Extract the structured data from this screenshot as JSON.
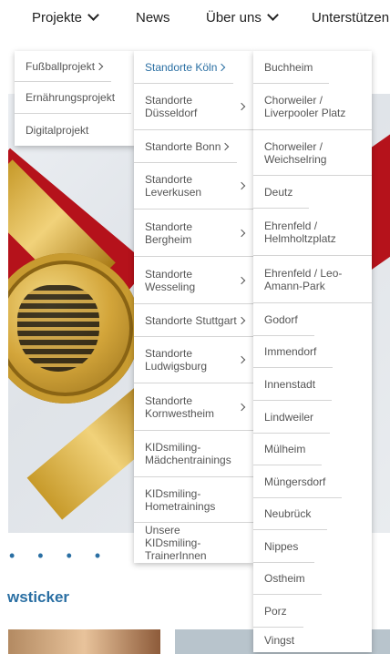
{
  "nav": {
    "items": [
      {
        "label": "Projekte",
        "has_chevron": true
      },
      {
        "label": "News",
        "has_chevron": false
      },
      {
        "label": "Über uns",
        "has_chevron": true
      },
      {
        "label": "Unterstützen",
        "has_chevron": false
      }
    ]
  },
  "menu_level1": [
    {
      "label": "Fußballprojekt",
      "has_arrow": true
    },
    {
      "label": "Ernährungsprojekt",
      "has_arrow": false
    },
    {
      "label": "Digitalprojekt",
      "has_arrow": false
    }
  ],
  "menu_level2": [
    {
      "label": "Standorte Köln",
      "has_arrow": true,
      "active": true
    },
    {
      "label": "Standorte Düsseldorf",
      "has_arrow": true
    },
    {
      "label": "Standorte Bonn",
      "has_arrow": true
    },
    {
      "label": "Standorte Leverkusen",
      "has_arrow": true
    },
    {
      "label": "Standorte Bergheim",
      "has_arrow": true
    },
    {
      "label": "Standorte Wesseling",
      "has_arrow": true
    },
    {
      "label": "Standorte Stuttgart",
      "has_arrow": true
    },
    {
      "label": "Standorte Ludwigsburg",
      "has_arrow": true
    },
    {
      "label": "Standorte Kornwestheim",
      "has_arrow": true
    },
    {
      "label": "KIDsmiling-Mädchentrainings",
      "has_arrow": false
    },
    {
      "label": "KIDsmiling-Hometrainings",
      "has_arrow": false
    },
    {
      "label": "Unsere KIDsmiling-TrainerInnen",
      "has_arrow": false
    }
  ],
  "menu_level3": [
    {
      "label": "Buchheim"
    },
    {
      "label": "Chorweiler / Liverpooler Platz"
    },
    {
      "label": "Chorweiler / Weichselring"
    },
    {
      "label": "Deutz"
    },
    {
      "label": "Ehrenfeld / Helmholtzplatz"
    },
    {
      "label": "Ehrenfeld / Leo-Amann-Park"
    },
    {
      "label": "Godorf"
    },
    {
      "label": "Immendorf"
    },
    {
      "label": "Innenstadt"
    },
    {
      "label": "Lindweiler"
    },
    {
      "label": "Mülheim"
    },
    {
      "label": "Müngersdorf"
    },
    {
      "label": "Neubrück"
    },
    {
      "label": "Nippes"
    },
    {
      "label": "Ostheim"
    },
    {
      "label": "Porz"
    },
    {
      "label": "Vingst"
    }
  ],
  "page": {
    "slider_dots": "• • • •",
    "section_title": "wsticker"
  },
  "colors": {
    "accent": "#2a6fa3",
    "text": "#555555"
  },
  "icons": {
    "nav_chevron": "chevron-down-icon",
    "menu_arrow": "chevron-right-icon"
  }
}
